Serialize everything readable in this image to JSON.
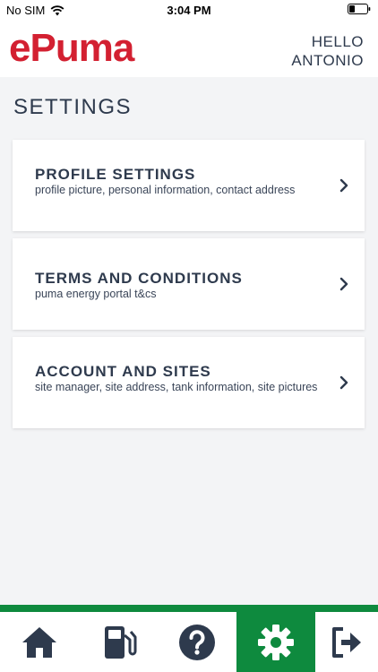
{
  "status": {
    "carrier": "No SIM",
    "time": "3:04 PM"
  },
  "header": {
    "logo": "ePuma",
    "greeting_line1": "HELLO",
    "greeting_line2": "ANTONIO"
  },
  "page": {
    "title": "SETTINGS"
  },
  "cards": [
    {
      "title": "PROFILE SETTINGS",
      "subtitle": "profile picture, personal information, contact address"
    },
    {
      "title": "TERMS AND CONDITIONS",
      "subtitle": "puma energy portal t&cs"
    },
    {
      "title": "ACCOUNT AND SITES",
      "subtitle": "site manager, site address, tank information, site pictures"
    }
  ],
  "nav": {
    "items": [
      "home-icon",
      "fuel-pump-icon",
      "help-icon",
      "settings-icon",
      "logout-icon"
    ],
    "active": "settings"
  },
  "colors": {
    "brand_red": "#d32031",
    "brand_green": "#0e8a3e",
    "text_dark": "#2e3a4d",
    "background": "#f3f4f6"
  }
}
